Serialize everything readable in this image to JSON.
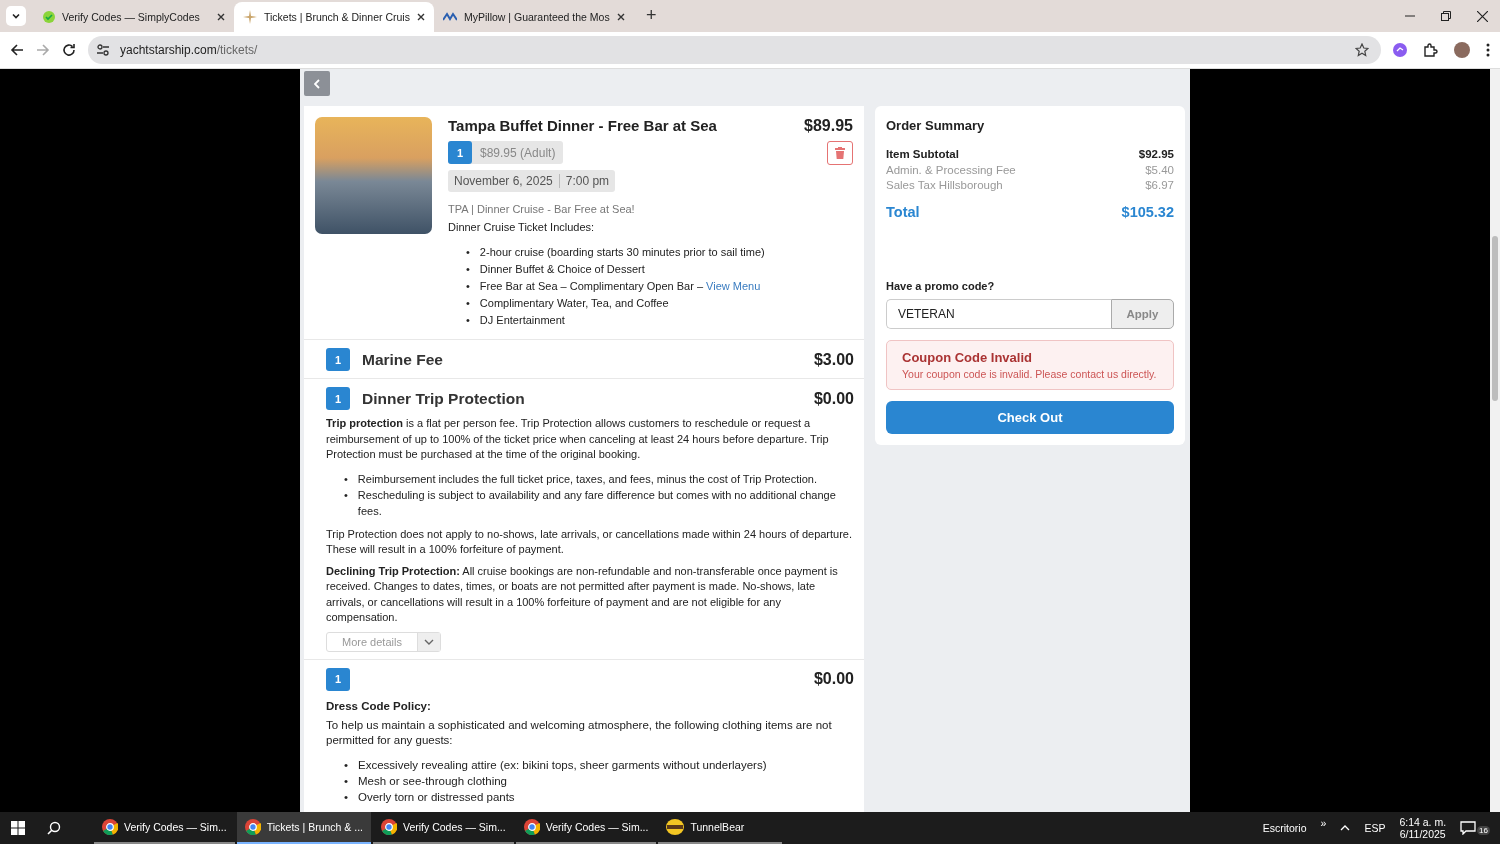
{
  "browser": {
    "tabs": [
      {
        "title": "Verify Codes — SimplyCodes",
        "kind": "check",
        "selected": false
      },
      {
        "title": "Tickets | Brunch & Dinner Cruis",
        "kind": "star",
        "selected": true
      },
      {
        "title": "MyPillow | Guaranteed the Mos",
        "kind": "logo",
        "selected": false
      }
    ],
    "new_tab": "+",
    "forward_disabled": true,
    "url_host": "yachtstarship.com",
    "url_path": "/tickets/"
  },
  "cart": {
    "main_item": {
      "title": "Tampa Buffet Dinner - Free Bar at Sea",
      "price": "$89.95",
      "quantity": "1",
      "rate": "$89.95 (Adult)",
      "date": "November 6, 2025",
      "time": "7:00 pm",
      "subtitle": "TPA | Dinner Cruise - Bar Free at Sea!",
      "includes_heading": "Dinner Cruise Ticket Includes:",
      "includes_marker": "•",
      "includes": [
        {
          "text": "2-hour cruise (boarding starts 30 minutes prior to sail time)"
        },
        {
          "text": "Dinner Buffet & Choice of Dessert"
        },
        {
          "text": "Free Bar at Sea – Complimentary Open Bar –",
          "link": "View Menu"
        },
        {
          "text": "Complimentary Water, Tea, and Coffee"
        },
        {
          "text": "DJ Entertainment"
        }
      ]
    },
    "sections": [
      {
        "quantity": "1",
        "name": "Marine Fee",
        "price": "$3.00"
      },
      {
        "quantity": "1",
        "name": "Dinner Trip Protection",
        "price": "$0.00",
        "blocks": [
          {
            "kind": "paragraph",
            "text": "**Trip protection** is a flat per person fee. Trip Protection allows customers to reschedule or request a reimbursement of up to 100% of the ticket price when canceling at least 24 hours before departure. Trip Protection must be purchased at the time of the original booking."
          },
          {
            "kind": "list",
            "marker": "•",
            "items": [
              "Reimbursement includes the full ticket price, taxes, and fees, minus the cost of Trip Protection.",
              "Rescheduling is subject to availability and any fare difference but comes with no additional change fees."
            ]
          },
          {
            "kind": "paragraph",
            "text": "Trip Protection does not apply to no-shows, late arrivals, or cancellations made within 24 hours of departure. These will result in a 100% forfeiture of payment."
          },
          {
            "kind": "paragraph",
            "text": "**Declining Trip Protection:** All cruise bookings are non-refundable and non-transferable once payment is received. Changes to dates, times, or boats are not permitted after payment is made. No-shows, late arrivals, or cancellations will result in a 100% forfeiture of payment and are not eligible for any compensation."
          },
          {
            "kind": "details",
            "text": "More details"
          }
        ]
      },
      {
        "quantity": "1",
        "price": "$0.00",
        "blocks": [
          {
            "kind": "heading",
            "text": "Dress Code Policy:"
          },
          {
            "kind": "plain",
            "text": "To help us maintain a sophisticated and welcoming atmosphere, the following clothing items are not permitted for any guests:"
          },
          {
            "kind": "plainlist",
            "marker": "•",
            "items": [
              "Excessively revealing attire (ex: bikini tops, sheer garments without underlayers)",
              "Mesh or see-through clothing",
              "Overly torn or distressed pants"
            ]
          }
        ]
      }
    ]
  },
  "summary": {
    "title": "Order Summary",
    "lines": [
      {
        "kind": "subtotal",
        "label": "Item Subtotal",
        "value": "$92.95"
      },
      {
        "kind": "fee",
        "label": "Admin. & Processing Fee",
        "value": "$5.40"
      },
      {
        "kind": "fee",
        "label": "Sales Tax Hillsborough",
        "value": "$6.97"
      }
    ],
    "total": {
      "label": "Total",
      "value": "$105.32"
    },
    "promo": {
      "label": "Have a promo code?",
      "value": "VETERAN",
      "button": "Apply"
    },
    "alert": {
      "title": "Coupon Code Invalid",
      "message": "Your coupon code is invalid. Please contact us directly."
    },
    "checkout": "Check Out"
  },
  "taskbar": {
    "apps": [
      {
        "kind": "chrome",
        "label": "Verify Codes — Sim...",
        "selected": false
      },
      {
        "kind": "chrome",
        "label": "Tickets | Brunch & ...",
        "selected": true
      },
      {
        "kind": "chrome",
        "label": "Verify Codes — Sim...",
        "selected": false
      },
      {
        "kind": "chrome",
        "label": "Verify Codes — Sim...",
        "selected": false
      },
      {
        "kind": "tunnelbear",
        "label": "TunnelBear",
        "selected": false
      }
    ],
    "desktop": "Escritorio",
    "overflow": "»",
    "language": "ESP",
    "time": "6:14 a. m.",
    "date": "6/11/2025",
    "notifications": "16"
  }
}
